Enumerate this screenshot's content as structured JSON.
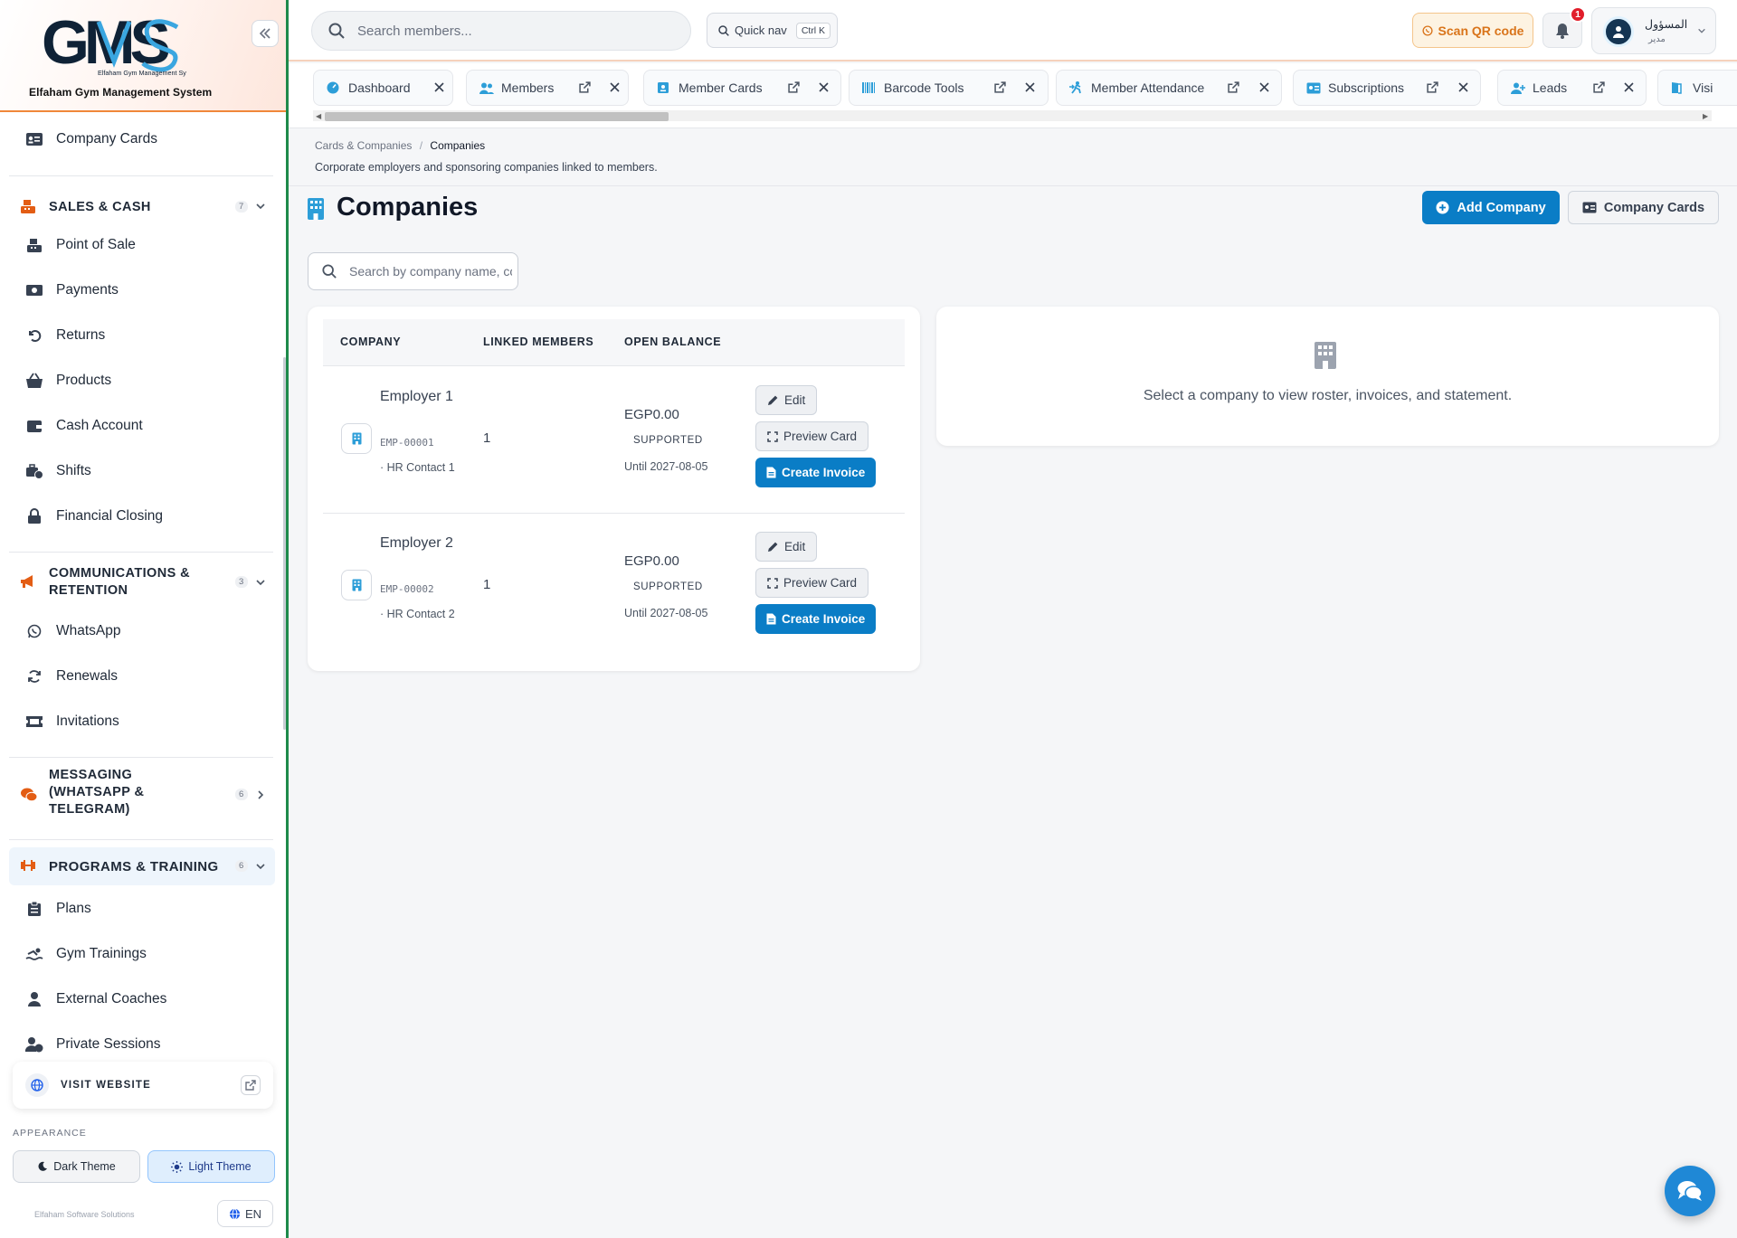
{
  "brand": {
    "logo_text": "GMS",
    "logo_sub_small": "Elfaham Gym Management System",
    "subtitle": "Elfaham Gym Management System"
  },
  "sidebar": {
    "top_item": "Company Cards",
    "sections": [
      {
        "label": "SALES & CASH",
        "count": "7",
        "items": [
          "Point of Sale",
          "Payments",
          "Returns",
          "Products",
          "Cash Account",
          "Shifts",
          "Financial Closing"
        ]
      },
      {
        "label": "COMMUNICATIONS & RETENTION",
        "count": "3",
        "items": [
          "WhatsApp",
          "Renewals",
          "Invitations"
        ]
      },
      {
        "label": "MESSAGING (WHATSAPP & TELEGRAM)",
        "count": "6",
        "items": []
      },
      {
        "label": "PROGRAMS & TRAINING",
        "count": "6",
        "items": [
          "Plans",
          "Gym Trainings",
          "External Coaches",
          "Private Sessions"
        ]
      }
    ],
    "visit_website": "VISIT WEBSITE",
    "appearance_label": "APPEARANCE",
    "dark_theme": "Dark Theme",
    "light_theme": "Light Theme",
    "footer": "Elfaham Software Solutions",
    "lang": "EN"
  },
  "topbar": {
    "search_placeholder": "Search members...",
    "quick_nav": "Quick nav",
    "quick_nav_kbd": "Ctrl K",
    "scan_qr": "Scan QR code",
    "notification_count": "1",
    "user_name": "المسؤول",
    "user_role": "مدير"
  },
  "tabs": [
    "Dashboard",
    "Members",
    "Member Cards",
    "Barcode Tools",
    "Member Attendance",
    "Subscriptions",
    "Leads",
    "Visi"
  ],
  "page": {
    "breadcrumb_parent": "Cards & Companies",
    "breadcrumb_sep": "/",
    "breadcrumb_current": "Companies",
    "description": "Corporate employers and sponsoring companies linked to members.",
    "title": "Companies",
    "add_company": "Add Company",
    "company_cards": "Company Cards",
    "search_placeholder": "Search by company name, code, or contact"
  },
  "table": {
    "headers": [
      "COMPANY",
      "LINKED MEMBERS",
      "OPEN BALANCE"
    ],
    "rows": [
      {
        "name": "Employer 1",
        "code": "EMP-00001",
        "contact": "· HR Contact 1",
        "linked": "1",
        "balance": "EGP0.00",
        "status": "SUPPORTED",
        "until": "Until 2027-08-05"
      },
      {
        "name": "Employer 2",
        "code": "EMP-00002",
        "contact": "· HR Contact 2",
        "linked": "1",
        "balance": "EGP0.00",
        "status": "SUPPORTED",
        "until": "Until 2027-08-05"
      }
    ],
    "actions": {
      "edit": "Edit",
      "preview": "Preview Card",
      "invoice": "Create Invoice"
    }
  },
  "detail": {
    "empty_text": "Select a company to view roster, invoices, and statement."
  },
  "colors": {
    "accent": "#0a7dc6",
    "sidebar_accent": "#e35d14",
    "sidebar_border": "#1e8a4b",
    "badge": "#e11d2a",
    "scan_orange": "#d9741a"
  }
}
